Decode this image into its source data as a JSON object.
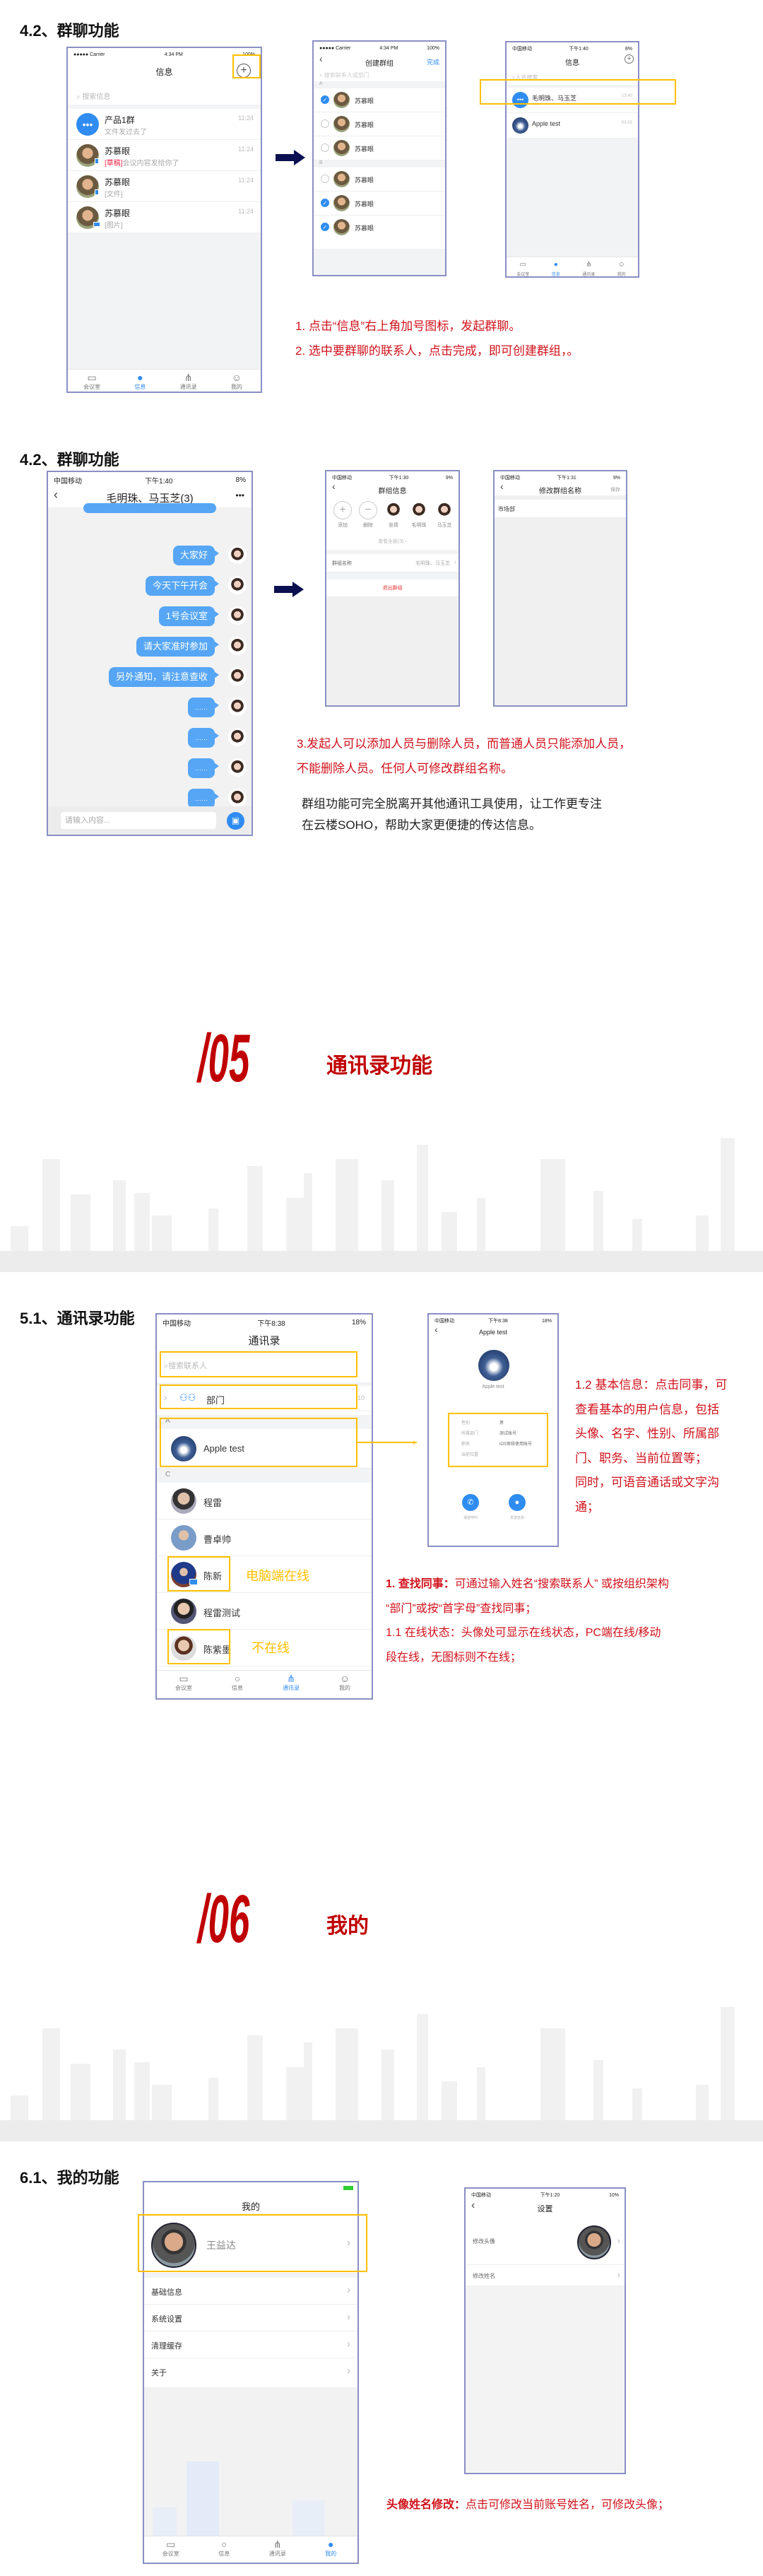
{
  "colors": {
    "accent_blue": "#2f8cf0",
    "highlight_yellow": "#ffbf00",
    "note_red": "#d0121b",
    "section_red": "#c00000",
    "arrow_navy": "#0b1050"
  },
  "tabs": [
    "会议室",
    "信息",
    "通讯录",
    "我的"
  ],
  "tab_icons": [
    "meeting-room-icon",
    "message-icon",
    "contacts-icon",
    "profile-icon"
  ],
  "s1": {
    "title": "4.2、群聊功能",
    "p1": {
      "carrier": "●●●●● Carrier",
      "time": "4:34 PM",
      "battery": "100%",
      "title": "信息",
      "search": "搜索信息",
      "rows": [
        {
          "name": "产品1群",
          "sub": "文件发过去了",
          "time": "11:24"
        },
        {
          "name": "苏慕眼",
          "draft": "[草稿]",
          "sub": "会议内容发给你了",
          "time": "11:24"
        },
        {
          "name": "苏慕眼",
          "sub": "[文件]",
          "time": "11:24"
        },
        {
          "name": "苏慕眼",
          "sub": "[图片]",
          "time": "11:24"
        }
      ]
    },
    "p2": {
      "carrier": "●●●●● Carrier",
      "time": "4:34 PM",
      "battery": "100%",
      "title": "创建群组",
      "done": "完成",
      "search": "搜索联系人或部门",
      "groups": [
        "A",
        "B"
      ],
      "rows": [
        {
          "name": "苏慕眼",
          "checked": true
        },
        {
          "name": "苏慕眼",
          "checked": false
        },
        {
          "name": "苏慕眼",
          "checked": false
        },
        {
          "name": "苏慕眼",
          "checked": false
        },
        {
          "name": "苏慕眼",
          "checked": true
        },
        {
          "name": "苏慕眼",
          "checked": true
        }
      ]
    },
    "p3": {
      "carrier": "中国移动",
      "time": "下午1:40",
      "battery": "8%",
      "title": "信息",
      "search": "人名搜索",
      "rows": [
        {
          "name": "毛明珠、马玉芝",
          "sub": "……",
          "time": "13:40"
        },
        {
          "name": "Apple test",
          "time": "03-03"
        }
      ]
    },
    "notes": [
      "1. 点击“信息”右上角加号图标，发起群聊。",
      "2. 选中要群聊的联系人，点击完成，即可创建群组，。"
    ]
  },
  "s2": {
    "title": "4.2、群聊功能",
    "p4": {
      "carrier": "中国移动",
      "time": "下午1:40",
      "battery": "8%",
      "title": "毛明珠、马玉芝(3)",
      "more": "•••",
      "messages": [
        "大家好",
        "今天下午开会",
        "1号会议室",
        "请大家准时参加",
        "另外通知，请注意查收",
        "……",
        "……",
        "……",
        "……"
      ],
      "input_placeholder": "请输入内容..."
    },
    "p5": {
      "carrier": "中国移动",
      "time": "下午1:30",
      "battery": "9%",
      "title": "群组信息",
      "members": [
        "添加",
        "删除",
        "张倩",
        "毛明珠",
        "马玉芝"
      ],
      "view_all": "查看全部(3)",
      "group_name_label": "群组名称",
      "group_name_value": "毛明珠、马玉芝",
      "quit": "退出群组"
    },
    "p6": {
      "carrier": "中国移动",
      "time": "下午1:31",
      "battery": "9%",
      "title": "修改群组名称",
      "save": "保存",
      "value": "市场部"
    },
    "notes": [
      "3.发起人可以添加人员与删除人员，而普通人员只能添加人员，",
      "不能删除人员。任何人可修改群组名称。"
    ],
    "desc": [
      "群组功能可完全脱离开其他通讯工具使用，让工作更专注",
      "在云楼SOHO，帮助大家更便捷的传达信息。"
    ]
  },
  "sec05": {
    "number": "/05",
    "title": "通讯录功能"
  },
  "s3": {
    "title": "5.1、通讯录功能",
    "p7": {
      "carrier": "中国移动",
      "time": "下午8:38",
      "battery": "18%",
      "title": "通讯录",
      "search": "搜索联系人",
      "dept": "部门",
      "dept_count": "10",
      "groups": [
        "A",
        "C"
      ],
      "apple": "Apple test",
      "contacts": [
        "程雷",
        "曹卓帅",
        "陈新",
        "程雷测试",
        "陈紫墨"
      ]
    },
    "label_online": "电脑端在线",
    "label_offline": "不在线",
    "p8": {
      "carrier": "中国移动",
      "time": "下午8:38",
      "battery": "18%",
      "title": "Apple test",
      "name": "Apple test",
      "info": [
        {
          "k": "性别",
          "v": "男"
        },
        {
          "k": "所属部门",
          "v": "测试账号"
        },
        {
          "k": "职务",
          "v": "iOS审核使用账号"
        },
        {
          "k": "当前位置",
          "v": ""
        }
      ],
      "call": "语音呼叫",
      "msg": "发送信息"
    },
    "note12": [
      "1.2 基本信息：点击同事，可",
      "查看基本的用户信息，包括",
      "头像、名字、性别、所属部",
      "门、职务、当前位置等；",
      "同时，可语音通话或文字沟",
      "通；"
    ],
    "note1_bold": "1. 查找同事：",
    "note1": [
      "可通过输入姓名“搜索联系人” 或按组织架构",
      "“部门”或按“首字母”查找同事；",
      "1.1 在线状态：头像处可显示在线状态，PC端在线/移动",
      "段在线，无图标则不在线；"
    ]
  },
  "sec06": {
    "number": "/06",
    "title": "我的"
  },
  "s4": {
    "title": "6.1、我的功能",
    "p9": {
      "title": "我的",
      "name": "王益达",
      "menu": [
        "基础信息",
        "系统设置",
        "清理缓存",
        "关于"
      ]
    },
    "p10": {
      "carrier": "中国移动",
      "time": "下午1:20",
      "battery": "10%",
      "title": "设置",
      "rows": [
        "修改头像",
        "修改姓名"
      ]
    },
    "note_bold": "头像姓名修改：",
    "note": "点击可修改当前账号姓名，可修改头像；"
  }
}
